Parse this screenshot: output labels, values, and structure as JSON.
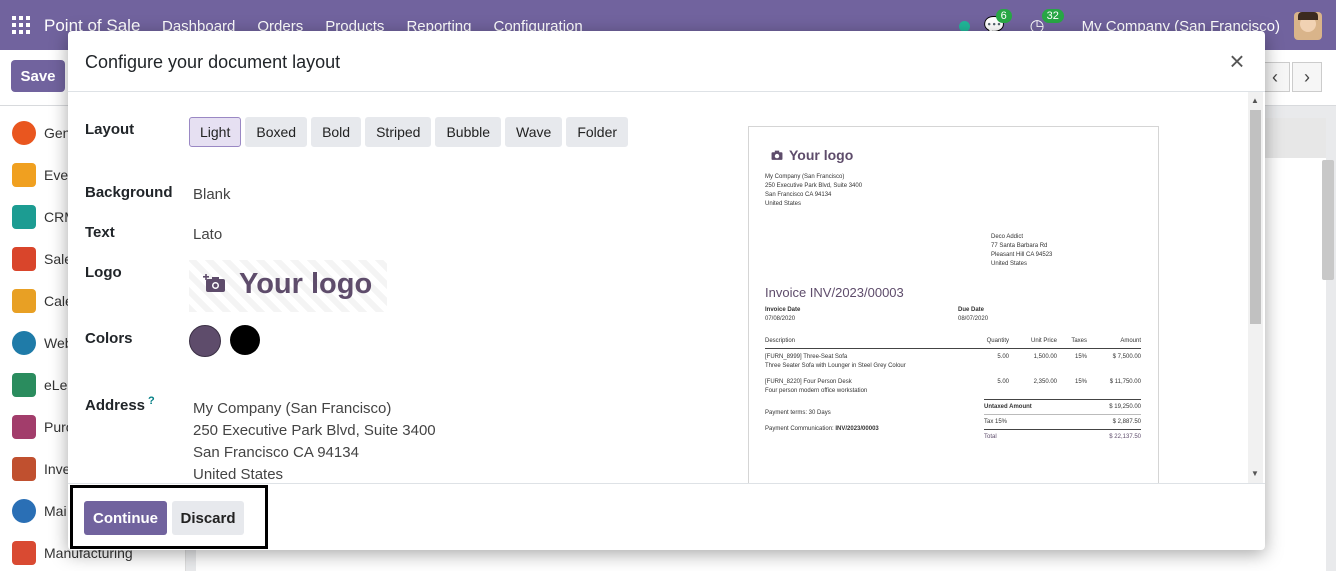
{
  "app": {
    "title": "Point of Sale",
    "menu": [
      "Dashboard",
      "Orders",
      "Products",
      "Reporting",
      "Configuration"
    ],
    "messages_count": "6",
    "activities_count": "32",
    "company": "My Company (San Francisco)",
    "save_label": "Save",
    "pager_prev": "‹",
    "pager_next": "›"
  },
  "sidebar": {
    "items": [
      {
        "label": "Gen",
        "color": "#e9561f"
      },
      {
        "label": "Ever",
        "color": "#f0a020"
      },
      {
        "label": "CRM",
        "color": "#1c9c92"
      },
      {
        "label": "Sale",
        "color": "#d9452b"
      },
      {
        "label": "Cale",
        "color": "#e8a024"
      },
      {
        "label": "Web",
        "color": "#1f7ba8"
      },
      {
        "label": "eLea",
        "color": "#2a8c5e"
      },
      {
        "label": "Purc",
        "color": "#a23d6b"
      },
      {
        "label": "Inve",
        "color": "#c0502f"
      },
      {
        "label": "Mai",
        "color": "#2a6fb5"
      },
      {
        "label": "Manufacturing",
        "color": "#d94a32"
      }
    ]
  },
  "modal": {
    "title": "Configure your document layout",
    "close_symbol": "×",
    "fields": {
      "layout_label": "Layout",
      "layout_options": [
        "Light",
        "Boxed",
        "Bold",
        "Striped",
        "Bubble",
        "Wave",
        "Folder"
      ],
      "layout_selected": "Light",
      "background_label": "Background",
      "background_value": "Blank",
      "text_label": "Text",
      "text_value": "Lato",
      "logo_label": "Logo",
      "logo_text": "Your logo",
      "colors_label": "Colors",
      "primary_color": "#5e4c6b",
      "secondary_color": "#000000",
      "address_label": "Address",
      "address_help": "?",
      "address_lines": [
        "My Company (San Francisco)",
        "250 Executive Park Blvd, Suite 3400",
        "San Francisco CA 94134",
        "United States"
      ]
    },
    "continue_label": "Continue",
    "discard_label": "Discard"
  },
  "preview": {
    "logo_text": "Your logo",
    "company_lines": [
      "My Company (San Francisco)",
      "250 Executive Park Blvd, Suite 3400",
      "San Francisco CA 94134",
      "United States"
    ],
    "customer_lines": [
      "Deco Addict",
      "77 Santa Barbara Rd",
      "Pleasant Hill CA 94523",
      "United States"
    ],
    "invoice_title": "Invoice INV/2023/00003",
    "invoice_date_label": "Invoice Date",
    "invoice_date": "07/08/2020",
    "due_date_label": "Due Date",
    "due_date": "08/07/2020",
    "columns": [
      "Description",
      "Quantity",
      "Unit Price",
      "Taxes",
      "Amount"
    ],
    "lines": [
      {
        "name": "[FURN_8999] Three-Seat Sofa",
        "desc": "Three Seater Sofa with Lounger in Steel Grey Colour",
        "qty": "5.00",
        "price": "1,500.00",
        "tax": "15%",
        "amount": "$ 7,500.00"
      },
      {
        "name": "[FURN_8220] Four Person Desk",
        "desc": "Four person modern office workstation",
        "qty": "5.00",
        "price": "2,350.00",
        "tax": "15%",
        "amount": "$ 11,750.00"
      }
    ],
    "payment_terms": "Payment terms: 30 Days",
    "payment_comm_label": "Payment Communication:",
    "payment_comm_value": "INV/2023/00003",
    "untaxed_label": "Untaxed Amount",
    "untaxed_value": "$ 19,250.00",
    "tax_label": "Tax 15%",
    "tax_value": "$ 2,887.50",
    "total_label": "Total",
    "total_value": "$ 22,137.50"
  }
}
